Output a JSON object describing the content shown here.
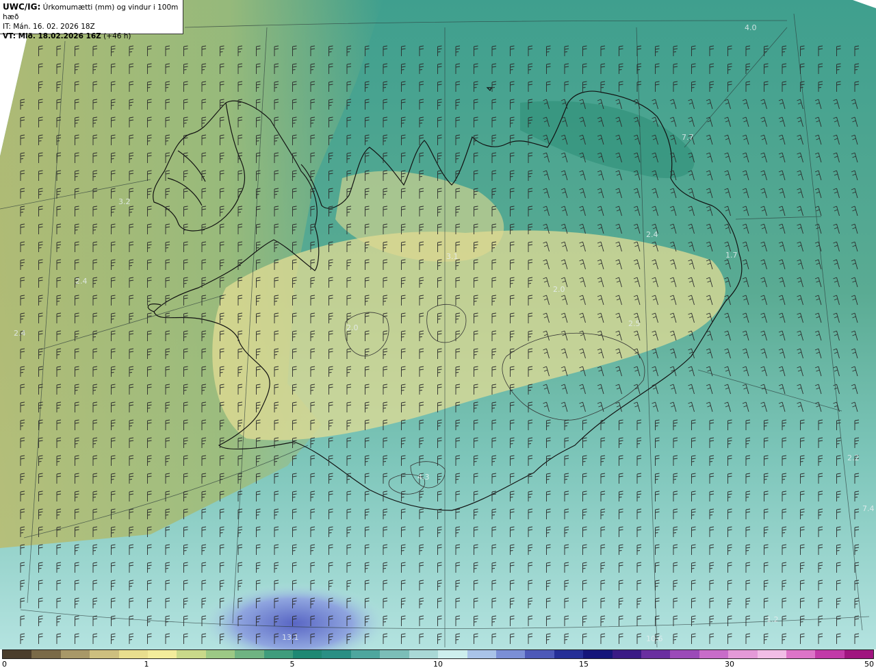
{
  "header": {
    "model": "UWC/IG:",
    "title": "Úrkomumætti (mm) og vindur i 100m hæð",
    "init_time": "IT: Mán. 16. 02. 2026 18Z",
    "valid_label": "VT: Mið. 18.02.2026 16Z",
    "lead_time": "(+46 h)"
  },
  "labels": [
    "4.0",
    "7.7",
    "3.2",
    "2.4",
    "2.4",
    "2.4",
    "3.1",
    "2.0",
    "2.5",
    "2.0",
    "1.7",
    "4.3",
    "2.2",
    "7.4",
    "13.1",
    "10.6",
    "1.2"
  ],
  "colorbar": {
    "ticks": [
      "0",
      "1",
      "5",
      "10",
      "15",
      "30",
      "50"
    ],
    "colors": [
      "#4a3d2c",
      "#7a6a48",
      "#a89868",
      "#cdbf7f",
      "#e8de8e",
      "#f3ec9b",
      "#c9d98a",
      "#9cc985",
      "#6fb382",
      "#3f9c7c",
      "#1f8873",
      "#2a8f84",
      "#4ea69e",
      "#7cbeb8",
      "#a9d8d6",
      "#cdeeed",
      "#a9c3e8",
      "#7b8fd6",
      "#4d59b8",
      "#262f97",
      "#15157a",
      "#3a1a85",
      "#6a2fa0",
      "#9b4ab8",
      "#c86cc9",
      "#e49ad8",
      "#f1bde6",
      "#dd74c8",
      "#c23aa8",
      "#a0157f"
    ]
  }
}
